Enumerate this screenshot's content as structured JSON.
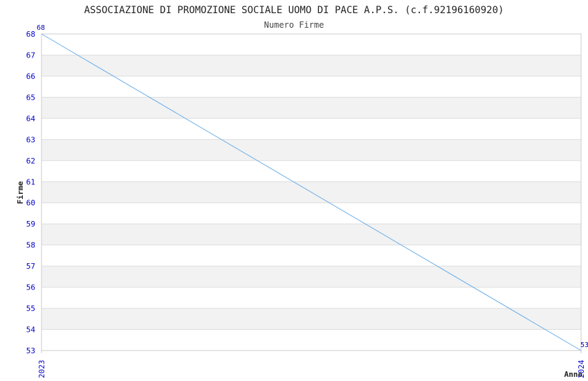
{
  "chart_data": {
    "type": "line",
    "title": "ASSOCIAZIONE DI PROMOZIONE SOCIALE UOMO DI PACE A.P.S. (c.f.92196160920)",
    "subtitle": "Numero Firme",
    "xlabel": "Anno",
    "ylabel": "Firme",
    "x": [
      "2023",
      "2024"
    ],
    "series": [
      {
        "values": [
          68,
          53
        ],
        "point_labels": [
          "68",
          "53"
        ]
      }
    ],
    "ylim": [
      53,
      68
    ],
    "yticks": [
      "53",
      "54",
      "55",
      "56",
      "57",
      "58",
      "59",
      "60",
      "61",
      "62",
      "63",
      "64",
      "65",
      "66",
      "67",
      "68"
    ],
    "grid": true,
    "colors": {
      "line": "#6aaee8",
      "tick_text": "#0000cc",
      "band": "#f2f2f2",
      "grid": "#dddddd",
      "title_text": "#222222"
    }
  }
}
